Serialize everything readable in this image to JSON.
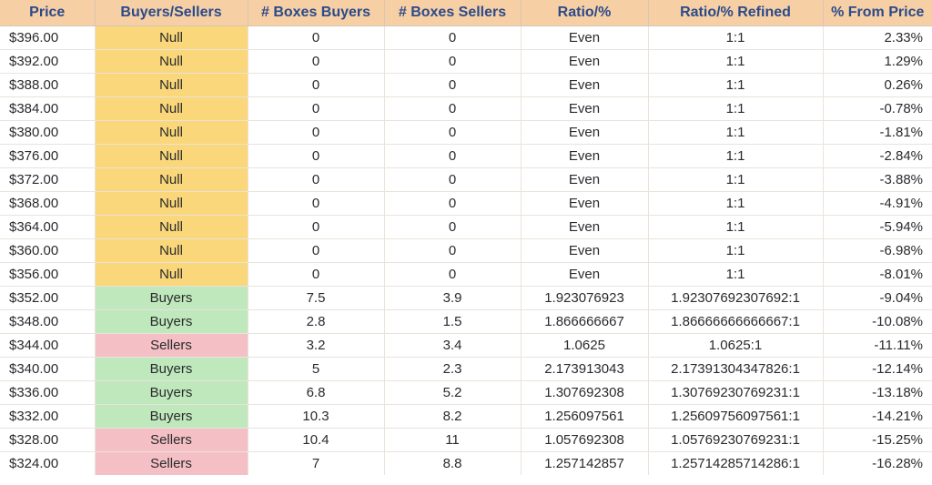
{
  "chart_data": {
    "type": "table",
    "title": "",
    "columns": [
      "Price",
      "Buyers/Sellers",
      "# Boxes Buyers",
      "# Boxes Sellers",
      "Ratio/%",
      "Ratio/% Refined",
      "% From Price"
    ],
    "rows": [
      {
        "price": "$396.00",
        "bs": "Null",
        "bb": "0",
        "bsd": "0",
        "ratio": "Even",
        "refined": "1:1",
        "pct": "2.33%"
      },
      {
        "price": "$392.00",
        "bs": "Null",
        "bb": "0",
        "bsd": "0",
        "ratio": "Even",
        "refined": "1:1",
        "pct": "1.29%"
      },
      {
        "price": "$388.00",
        "bs": "Null",
        "bb": "0",
        "bsd": "0",
        "ratio": "Even",
        "refined": "1:1",
        "pct": "0.26%"
      },
      {
        "price": "$384.00",
        "bs": "Null",
        "bb": "0",
        "bsd": "0",
        "ratio": "Even",
        "refined": "1:1",
        "pct": "-0.78%"
      },
      {
        "price": "$380.00",
        "bs": "Null",
        "bb": "0",
        "bsd": "0",
        "ratio": "Even",
        "refined": "1:1",
        "pct": "-1.81%"
      },
      {
        "price": "$376.00",
        "bs": "Null",
        "bb": "0",
        "bsd": "0",
        "ratio": "Even",
        "refined": "1:1",
        "pct": "-2.84%"
      },
      {
        "price": "$372.00",
        "bs": "Null",
        "bb": "0",
        "bsd": "0",
        "ratio": "Even",
        "refined": "1:1",
        "pct": "-3.88%"
      },
      {
        "price": "$368.00",
        "bs": "Null",
        "bb": "0",
        "bsd": "0",
        "ratio": "Even",
        "refined": "1:1",
        "pct": "-4.91%"
      },
      {
        "price": "$364.00",
        "bs": "Null",
        "bb": "0",
        "bsd": "0",
        "ratio": "Even",
        "refined": "1:1",
        "pct": "-5.94%"
      },
      {
        "price": "$360.00",
        "bs": "Null",
        "bb": "0",
        "bsd": "0",
        "ratio": "Even",
        "refined": "1:1",
        "pct": "-6.98%"
      },
      {
        "price": "$356.00",
        "bs": "Null",
        "bb": "0",
        "bsd": "0",
        "ratio": "Even",
        "refined": "1:1",
        "pct": "-8.01%"
      },
      {
        "price": "$352.00",
        "bs": "Buyers",
        "bb": "7.5",
        "bsd": "3.9",
        "ratio": "1.923076923",
        "refined": "1.92307692307692:1",
        "pct": "-9.04%"
      },
      {
        "price": "$348.00",
        "bs": "Buyers",
        "bb": "2.8",
        "bsd": "1.5",
        "ratio": "1.866666667",
        "refined": "1.86666666666667:1",
        "pct": "-10.08%"
      },
      {
        "price": "$344.00",
        "bs": "Sellers",
        "bb": "3.2",
        "bsd": "3.4",
        "ratio": "1.0625",
        "refined": "1.0625:1",
        "pct": "-11.11%"
      },
      {
        "price": "$340.00",
        "bs": "Buyers",
        "bb": "5",
        "bsd": "2.3",
        "ratio": "2.173913043",
        "refined": "2.17391304347826:1",
        "pct": "-12.14%"
      },
      {
        "price": "$336.00",
        "bs": "Buyers",
        "bb": "6.8",
        "bsd": "5.2",
        "ratio": "1.307692308",
        "refined": "1.30769230769231:1",
        "pct": "-13.18%"
      },
      {
        "price": "$332.00",
        "bs": "Buyers",
        "bb": "10.3",
        "bsd": "8.2",
        "ratio": "1.256097561",
        "refined": "1.25609756097561:1",
        "pct": "-14.21%"
      },
      {
        "price": "$328.00",
        "bs": "Sellers",
        "bb": "10.4",
        "bsd": "11",
        "ratio": "1.057692308",
        "refined": "1.05769230769231:1",
        "pct": "-15.25%"
      },
      {
        "price": "$324.00",
        "bs": "Sellers",
        "bb": "7",
        "bsd": "8.8",
        "ratio": "1.257142857",
        "refined": "1.25714285714286:1",
        "pct": "-16.28%"
      }
    ]
  }
}
